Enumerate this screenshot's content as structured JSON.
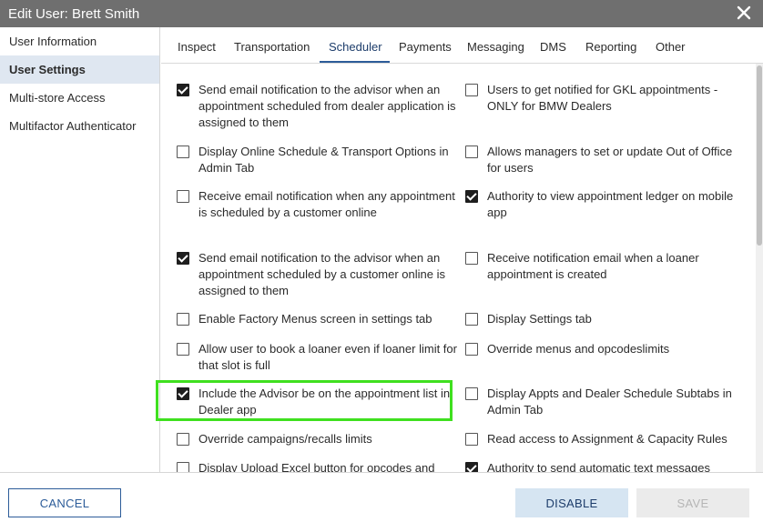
{
  "dialog": {
    "title": "Edit User: Brett Smith",
    "close_icon": "close-icon"
  },
  "sidebar": {
    "items": [
      {
        "label": "User Information",
        "active": false
      },
      {
        "label": "User Settings",
        "active": true
      },
      {
        "label": "Multi-store Access",
        "active": false
      },
      {
        "label": "Multifactor Authenticator",
        "active": false
      }
    ]
  },
  "tabs": [
    {
      "label": "Inspect",
      "active": false
    },
    {
      "label": "Transportation",
      "active": false
    },
    {
      "label": "Scheduler",
      "active": true
    },
    {
      "label": "Payments",
      "active": false
    },
    {
      "label": "Messaging",
      "active": false
    },
    {
      "label": "DMS",
      "active": false
    },
    {
      "label": "Reporting",
      "active": false
    },
    {
      "label": "Other",
      "active": false
    }
  ],
  "options_left": [
    {
      "label": "Send email notification to the advisor when an appointment scheduled from dealer application is assigned to them",
      "checked": true
    },
    {
      "label": "Display Online Schedule & Transport Options in Admin Tab",
      "checked": false
    },
    {
      "label": "Receive email notification when any appointment is scheduled by a customer online",
      "checked": false
    },
    {
      "label": "Send email notification to the advisor when an appointment scheduled by a customer online is assigned to them",
      "checked": true
    },
    {
      "label": "Enable Factory Menus screen in settings tab",
      "checked": false
    },
    {
      "label": "Allow user to book a loaner even if loaner limit for that slot is full",
      "checked": false
    },
    {
      "label": "Include the Advisor be on the appointment list in Dealer app",
      "checked": true
    },
    {
      "label": "Override campaigns/recalls limits",
      "checked": false
    },
    {
      "label": "Display Upload Excel button for opcodes and",
      "checked": false
    }
  ],
  "options_right": [
    {
      "label": "Users to get notified for GKL appointments - ONLY for BMW Dealers",
      "checked": false
    },
    {
      "label": "Allows managers to set or update Out of Office for users",
      "checked": false
    },
    {
      "label": "Authority to view appointment ledger on mobile app",
      "checked": true
    },
    {
      "label": "Receive notification email when a loaner appointment is created",
      "checked": false
    },
    {
      "label": "Display Settings tab",
      "checked": false
    },
    {
      "label": "Override menus and opcodeslimits",
      "checked": false
    },
    {
      "label": "Display Appts and Dealer Schedule Subtabs in Admin Tab",
      "checked": false
    },
    {
      "label": "Read access to Assignment & Capacity Rules",
      "checked": false
    },
    {
      "label": "Authority to send automatic text messages",
      "checked": true
    }
  ],
  "footer": {
    "cancel_label": "CANCEL",
    "disable_label": "DISABLE",
    "save_label": "SAVE"
  },
  "colors": {
    "titlebar": "#6f6f6f",
    "accent": "#2c5c99",
    "highlight_marker": "#f6f62c",
    "annotation_box": "#3fe01f"
  }
}
